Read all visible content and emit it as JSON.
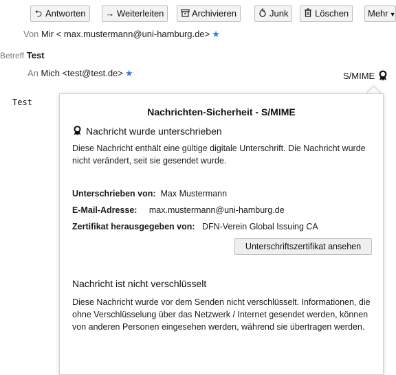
{
  "toolbar": {
    "reply": "Antworten",
    "forward": "Weiterleiten",
    "archive": "Archivieren",
    "junk": "Junk",
    "delete": "Löschen",
    "more": "Mehr"
  },
  "header": {
    "from_label": "Von",
    "from_value": "Mir < max.mustermann@uni-hamburg.de>",
    "subject_label": "Betreff",
    "subject_value": "Test",
    "to_label": "An",
    "to_value": "Mich <test@test.de>",
    "smime_label": "S/MIME"
  },
  "message": {
    "body": "Test"
  },
  "popup": {
    "title": "Nachrichten-Sicherheit - S/MIME",
    "signed_heading": "Nachricht wurde unterschrieben",
    "signed_text": "Diese Nachricht enthält eine gültige digitale Unterschrift. Die Nachricht wurde nicht verändert, seit sie gesendet wurde.",
    "signed_by_label": "Unterschrieben von:",
    "signed_by_value": "Max Mustermann",
    "email_label": "E-Mail-Adresse:",
    "email_value": "max.mustermann@uni-hamburg.de",
    "issuer_label": "Zertifikat herausgegeben von:",
    "issuer_value": "DFN-Verein Global Issuing CA",
    "view_cert_button": "Unterschriftszertifikat ansehen",
    "encryption_heading": "Nachricht ist nicht verschlüsselt",
    "encryption_text": "Diese Nachricht wurde vor dem Senden nicht verschlüsselt. Informationen, die ohne Verschlüsselung über das Netzwerk / Internet gesendet werden, können von anderen Personen eingesehen werden, während sie übertragen werden."
  }
}
